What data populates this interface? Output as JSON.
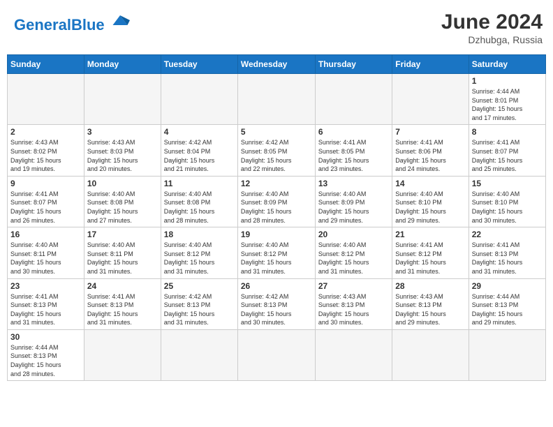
{
  "header": {
    "logo_general": "General",
    "logo_blue": "Blue",
    "month_year": "June 2024",
    "location": "Dzhubga, Russia"
  },
  "weekdays": [
    "Sunday",
    "Monday",
    "Tuesday",
    "Wednesday",
    "Thursday",
    "Friday",
    "Saturday"
  ],
  "weeks": [
    [
      {
        "day": "",
        "info": ""
      },
      {
        "day": "",
        "info": ""
      },
      {
        "day": "",
        "info": ""
      },
      {
        "day": "",
        "info": ""
      },
      {
        "day": "",
        "info": ""
      },
      {
        "day": "",
        "info": ""
      },
      {
        "day": "1",
        "info": "Sunrise: 4:44 AM\nSunset: 8:01 PM\nDaylight: 15 hours\nand 17 minutes."
      }
    ],
    [
      {
        "day": "2",
        "info": "Sunrise: 4:43 AM\nSunset: 8:02 PM\nDaylight: 15 hours\nand 19 minutes."
      },
      {
        "day": "3",
        "info": "Sunrise: 4:43 AM\nSunset: 8:03 PM\nDaylight: 15 hours\nand 20 minutes."
      },
      {
        "day": "4",
        "info": "Sunrise: 4:42 AM\nSunset: 8:04 PM\nDaylight: 15 hours\nand 21 minutes."
      },
      {
        "day": "5",
        "info": "Sunrise: 4:42 AM\nSunset: 8:05 PM\nDaylight: 15 hours\nand 22 minutes."
      },
      {
        "day": "6",
        "info": "Sunrise: 4:41 AM\nSunset: 8:05 PM\nDaylight: 15 hours\nand 23 minutes."
      },
      {
        "day": "7",
        "info": "Sunrise: 4:41 AM\nSunset: 8:06 PM\nDaylight: 15 hours\nand 24 minutes."
      },
      {
        "day": "8",
        "info": "Sunrise: 4:41 AM\nSunset: 8:07 PM\nDaylight: 15 hours\nand 25 minutes."
      }
    ],
    [
      {
        "day": "9",
        "info": "Sunrise: 4:41 AM\nSunset: 8:07 PM\nDaylight: 15 hours\nand 26 minutes."
      },
      {
        "day": "10",
        "info": "Sunrise: 4:40 AM\nSunset: 8:08 PM\nDaylight: 15 hours\nand 27 minutes."
      },
      {
        "day": "11",
        "info": "Sunrise: 4:40 AM\nSunset: 8:08 PM\nDaylight: 15 hours\nand 28 minutes."
      },
      {
        "day": "12",
        "info": "Sunrise: 4:40 AM\nSunset: 8:09 PM\nDaylight: 15 hours\nand 28 minutes."
      },
      {
        "day": "13",
        "info": "Sunrise: 4:40 AM\nSunset: 8:09 PM\nDaylight: 15 hours\nand 29 minutes."
      },
      {
        "day": "14",
        "info": "Sunrise: 4:40 AM\nSunset: 8:10 PM\nDaylight: 15 hours\nand 29 minutes."
      },
      {
        "day": "15",
        "info": "Sunrise: 4:40 AM\nSunset: 8:10 PM\nDaylight: 15 hours\nand 30 minutes."
      }
    ],
    [
      {
        "day": "16",
        "info": "Sunrise: 4:40 AM\nSunset: 8:11 PM\nDaylight: 15 hours\nand 30 minutes."
      },
      {
        "day": "17",
        "info": "Sunrise: 4:40 AM\nSunset: 8:11 PM\nDaylight: 15 hours\nand 31 minutes."
      },
      {
        "day": "18",
        "info": "Sunrise: 4:40 AM\nSunset: 8:12 PM\nDaylight: 15 hours\nand 31 minutes."
      },
      {
        "day": "19",
        "info": "Sunrise: 4:40 AM\nSunset: 8:12 PM\nDaylight: 15 hours\nand 31 minutes."
      },
      {
        "day": "20",
        "info": "Sunrise: 4:40 AM\nSunset: 8:12 PM\nDaylight: 15 hours\nand 31 minutes."
      },
      {
        "day": "21",
        "info": "Sunrise: 4:41 AM\nSunset: 8:12 PM\nDaylight: 15 hours\nand 31 minutes."
      },
      {
        "day": "22",
        "info": "Sunrise: 4:41 AM\nSunset: 8:13 PM\nDaylight: 15 hours\nand 31 minutes."
      }
    ],
    [
      {
        "day": "23",
        "info": "Sunrise: 4:41 AM\nSunset: 8:13 PM\nDaylight: 15 hours\nand 31 minutes."
      },
      {
        "day": "24",
        "info": "Sunrise: 4:41 AM\nSunset: 8:13 PM\nDaylight: 15 hours\nand 31 minutes."
      },
      {
        "day": "25",
        "info": "Sunrise: 4:42 AM\nSunset: 8:13 PM\nDaylight: 15 hours\nand 31 minutes."
      },
      {
        "day": "26",
        "info": "Sunrise: 4:42 AM\nSunset: 8:13 PM\nDaylight: 15 hours\nand 30 minutes."
      },
      {
        "day": "27",
        "info": "Sunrise: 4:43 AM\nSunset: 8:13 PM\nDaylight: 15 hours\nand 30 minutes."
      },
      {
        "day": "28",
        "info": "Sunrise: 4:43 AM\nSunset: 8:13 PM\nDaylight: 15 hours\nand 29 minutes."
      },
      {
        "day": "29",
        "info": "Sunrise: 4:44 AM\nSunset: 8:13 PM\nDaylight: 15 hours\nand 29 minutes."
      }
    ],
    [
      {
        "day": "30",
        "info": "Sunrise: 4:44 AM\nSunset: 8:13 PM\nDaylight: 15 hours\nand 28 minutes."
      },
      {
        "day": "",
        "info": ""
      },
      {
        "day": "",
        "info": ""
      },
      {
        "day": "",
        "info": ""
      },
      {
        "day": "",
        "info": ""
      },
      {
        "day": "",
        "info": ""
      },
      {
        "day": "",
        "info": ""
      }
    ]
  ]
}
